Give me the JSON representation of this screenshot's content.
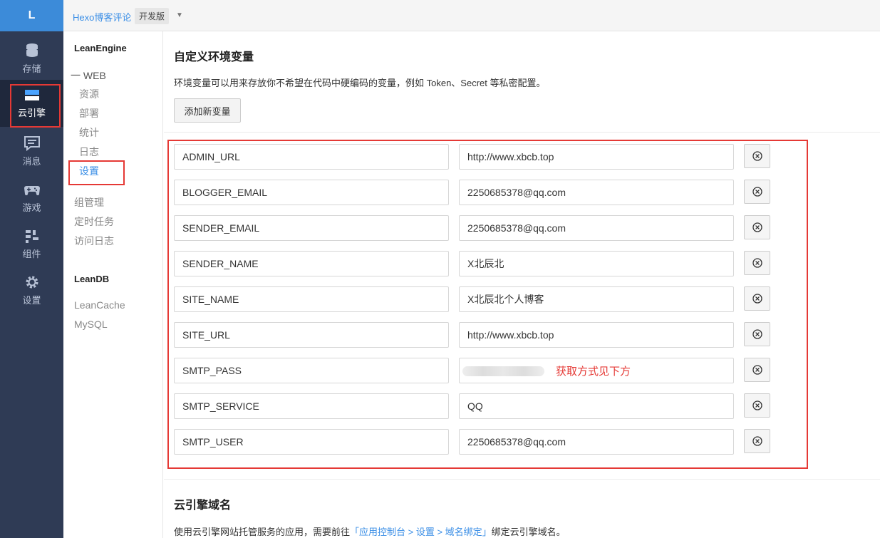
{
  "rail": {
    "logo": "L",
    "items": [
      {
        "label": "存储",
        "icon": "database-icon"
      },
      {
        "label": "云引擎",
        "icon": "cloud-engine-icon"
      },
      {
        "label": "消息",
        "icon": "message-icon"
      },
      {
        "label": "游戏",
        "icon": "gamepad-icon"
      },
      {
        "label": "组件",
        "icon": "components-icon"
      },
      {
        "label": "设置",
        "icon": "gear-icon"
      }
    ]
  },
  "topbar": {
    "app_name": "Hexo博客评论",
    "env_badge": "开发版",
    "caret": "▼"
  },
  "subnav": {
    "section1": "LeanEngine",
    "group": "一 WEB",
    "items": [
      "资源",
      "部署",
      "统计",
      "日志",
      "设置"
    ],
    "others": [
      "组管理",
      "定时任务",
      "访问日志"
    ],
    "section2": "LeanDB",
    "db_items": [
      "LeanCache",
      "MySQL"
    ]
  },
  "main": {
    "title": "自定义环境变量",
    "desc": "环境变量可以用来存放你不希望在代码中硬编码的变量，例如 Token、Secret 等私密配置。",
    "add_button": "添加新变量",
    "env_vars": [
      {
        "key": "ADMIN_URL",
        "value": "http://www.xbcb.top"
      },
      {
        "key": "BLOGGER_EMAIL",
        "value": "2250685378@qq.com"
      },
      {
        "key": "SENDER_EMAIL",
        "value": "2250685378@qq.com"
      },
      {
        "key": "SENDER_NAME",
        "value": "X北辰北"
      },
      {
        "key": "SITE_NAME",
        "value": "X北辰北个人博客"
      },
      {
        "key": "SITE_URL",
        "value": "http://www.xbcb.top"
      },
      {
        "key": "SMTP_PASS",
        "value": ""
      },
      {
        "key": "SMTP_SERVICE",
        "value": "QQ"
      },
      {
        "key": "SMTP_USER",
        "value": "2250685378@qq.com"
      }
    ],
    "smtp_pass_note": "获取方式见下方",
    "domain_title": "云引擎域名",
    "domain_desc_prefix": "使用云引擎网站托管服务的应用，需要前往",
    "domain_link": "「应用控制台 > 设置 > 域名绑定」",
    "domain_desc_suffix": "绑定云引擎域名。"
  },
  "colors": {
    "rail_bg": "#2f3b55",
    "accent": "#3a8ee6",
    "highlight_red": "#e53935"
  }
}
